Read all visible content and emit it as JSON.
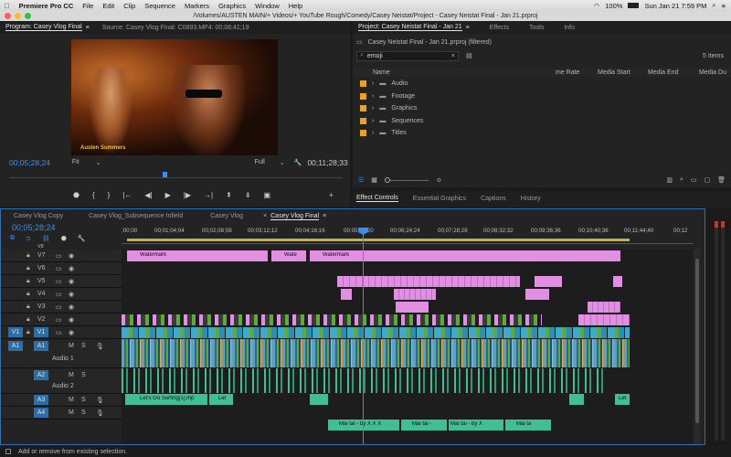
{
  "menubar": {
    "app": "Premiere Pro CC",
    "items": [
      "File",
      "Edit",
      "Clip",
      "Sequence",
      "Markers",
      "Graphics",
      "Window",
      "Help"
    ],
    "battery": "100%",
    "clock": "Sun Jan 21  7:59 PM"
  },
  "titlebar": {
    "path": "/Volumes/AUSTEN MAIN/+ Videos/+ YouTube Rough/Comedy/Casey Neistat/Project - Casey Neistat Final - Jan 21.prproj"
  },
  "program": {
    "tab": "Program: Casey Vlog Final",
    "source": "Source: Casey Vlog Final: C0893.MP4: 00;08;41;19",
    "watermark": "Austen Summers",
    "timecode": "00;05;28;24",
    "fit": "Fit",
    "quality": "Full",
    "duration": "00;11;28;33"
  },
  "project": {
    "tabs": [
      "Project: Casey Neistat Final - Jan 21",
      "Effects",
      "Tools",
      "Info"
    ],
    "filename": "Casey Neistat Final - Jan 21.prproj (filtered)",
    "search_value": "emoji",
    "items_count": "5 Items",
    "columns": [
      "Name",
      "me Rate",
      "Media Start",
      "Media End",
      "Media Du"
    ],
    "bins": [
      "Audio",
      "Footage",
      "Graphics",
      "Sequences",
      "Titles"
    ]
  },
  "lower_tabs": [
    "Effect Controls",
    "Essential Graphics",
    "Captions",
    "History"
  ],
  "timeline": {
    "tabs": [
      "Casey Vlog Copy",
      "Casey Vlog_Subsequence Infield",
      "Casey Vlog",
      "Casey Vlog Final"
    ],
    "timecode": "00;05;28;24",
    "ruler": [
      ";00;00",
      "00;01;04;04",
      "00;02;08;08",
      "00;03;12;12",
      "00;04;16;16",
      "00;05;20;20",
      "00;06;24;24",
      "00;07;28;28",
      "00;08;32;32",
      "00;09;36;36",
      "00;10;40;36",
      "00;11;44;40",
      "00;12"
    ],
    "video_tracks": [
      "V7",
      "V6",
      "V5",
      "V4",
      "V3",
      "V2",
      "V1"
    ],
    "audio_tracks": [
      "A1",
      "A2",
      "A3",
      "A4"
    ],
    "audio_names": [
      "Audio 1",
      "Audio 2"
    ],
    "v8": "V8",
    "src_v1": "V1",
    "src_a1": "A1",
    "watermark_label": "Watermark",
    "watermark_short": "Wate",
    "a3_label": "Let's Go Surfing[1].mp",
    "a3_short": "Let",
    "a4_label1": "Mai tai - by X X X",
    "a4_label2": "Mai tai -",
    "a4_label3": "Mai tai - by X",
    "a4_label4": "Mai ta"
  },
  "status": {
    "text": "Add or remove from existing selection."
  },
  "colors": {
    "accent": "#3a8eed",
    "v1": "#3fa9c9",
    "v2": "#5fa839",
    "pink": "#e18ee3",
    "audio": "#3fbf93"
  }
}
